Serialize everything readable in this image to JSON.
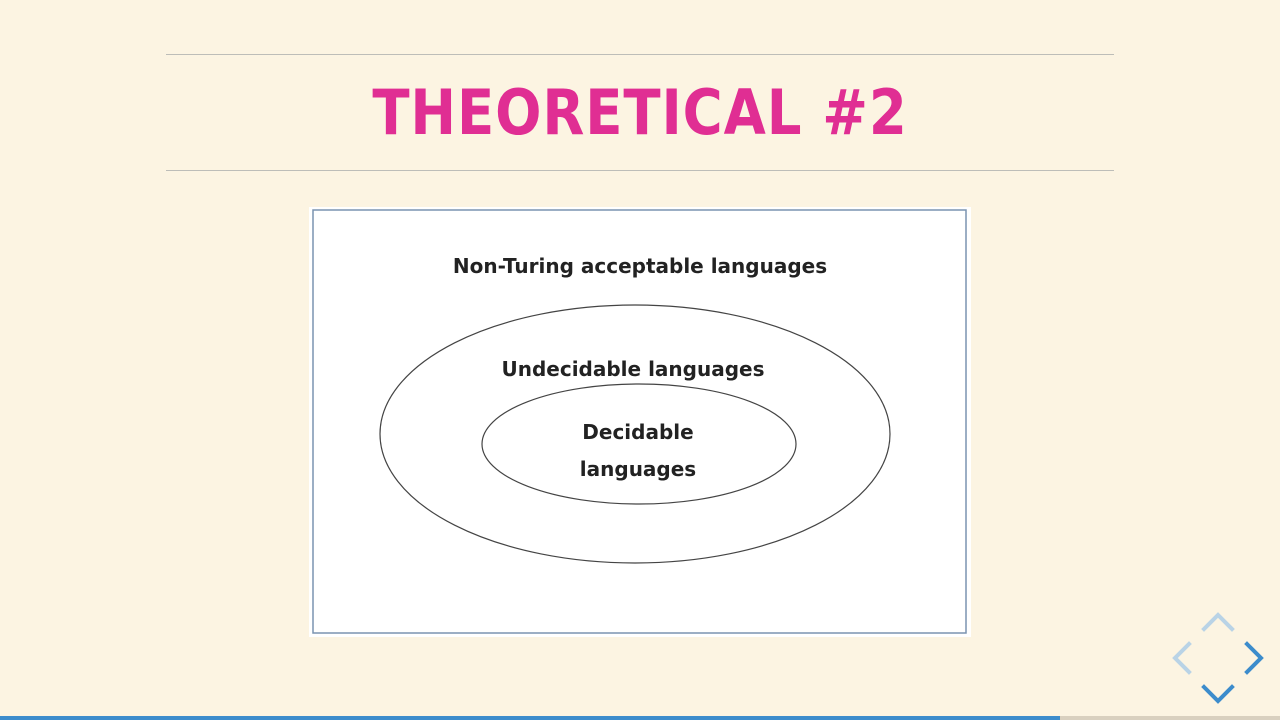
{
  "slide": {
    "title": "THEORETICAL #2"
  },
  "diagram": {
    "outer_label": "Non-Turing acceptable languages",
    "middle_label": "Undecidable languages",
    "inner_label": "Decidable languages"
  },
  "navigation": {
    "controls": [
      "navigate-up",
      "navigate-left",
      "navigate-right",
      "navigate-down"
    ],
    "enabled": [
      "navigate-right",
      "navigate-down"
    ]
  },
  "progress": {
    "fraction": 0.828
  },
  "colors": {
    "background": "#fcf4e2",
    "title": "#e02e93",
    "nav_enabled": "#3c8ccc",
    "nav_disabled": "#b9d3e6"
  }
}
